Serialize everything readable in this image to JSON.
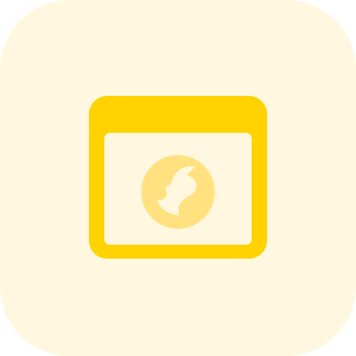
{
  "icon": {
    "name": "browser-globe-icon",
    "colors": {
      "tile_background": "#FFF7DF",
      "window_frame": "#FFD200",
      "window_content": "#FFF7DF",
      "globe": "#FFE27F"
    }
  }
}
